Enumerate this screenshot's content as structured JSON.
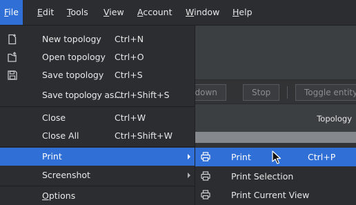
{
  "menubar": {
    "items": [
      {
        "label_pre": "",
        "label_u": "F",
        "label_post": "ile"
      },
      {
        "label_pre": "",
        "label_u": "E",
        "label_post": "dit"
      },
      {
        "label_pre": "",
        "label_u": "T",
        "label_post": "ools"
      },
      {
        "label_pre": "",
        "label_u": "V",
        "label_post": "iew"
      },
      {
        "label_pre": "",
        "label_u": "A",
        "label_post": "ccount"
      },
      {
        "label_pre": "",
        "label_u": "W",
        "label_post": "indow"
      },
      {
        "label_pre": "",
        "label_u": "H",
        "label_post": "elp"
      }
    ]
  },
  "file_menu": {
    "items": [
      {
        "label": "New topology",
        "shortcut": "Ctrl+N",
        "icon": "new-file-icon"
      },
      {
        "label": "Open topology",
        "shortcut": "Ctrl+O",
        "icon": "open-file-icon"
      },
      {
        "label": "Save topology",
        "shortcut": "Ctrl+S",
        "icon": "save-icon"
      },
      {
        "label": "Save topology as...",
        "shortcut": "Ctrl+Shift+S"
      },
      {
        "label": "Close",
        "shortcut": "Ctrl+W"
      },
      {
        "label": "Close All",
        "shortcut": "Ctrl+Shift+W"
      },
      {
        "label": "Print",
        "shortcut": ""
      },
      {
        "label": "Screenshot",
        "shortcut": ""
      },
      {
        "label_u": "O",
        "label_post": "ptions",
        "shortcut": ""
      }
    ]
  },
  "print_submenu": {
    "items": [
      {
        "label": "Print",
        "shortcut": "Ctrl+P",
        "icon": "printer-icon"
      },
      {
        "label": "Print Selection",
        "shortcut": "",
        "icon": "printer-icon"
      },
      {
        "label": "Print Current View",
        "shortcut": "",
        "icon": "printer-icon"
      }
    ]
  },
  "toolbar": {
    "shutdown_label": "Shutdown",
    "stop_label": "Stop",
    "toggle_label": "Toggle entity"
  },
  "topology_label": "Topology",
  "colors": {
    "accent": "#2f6fd6",
    "menu_bg": "#2b2d30",
    "window_bg": "#3c3f41"
  }
}
